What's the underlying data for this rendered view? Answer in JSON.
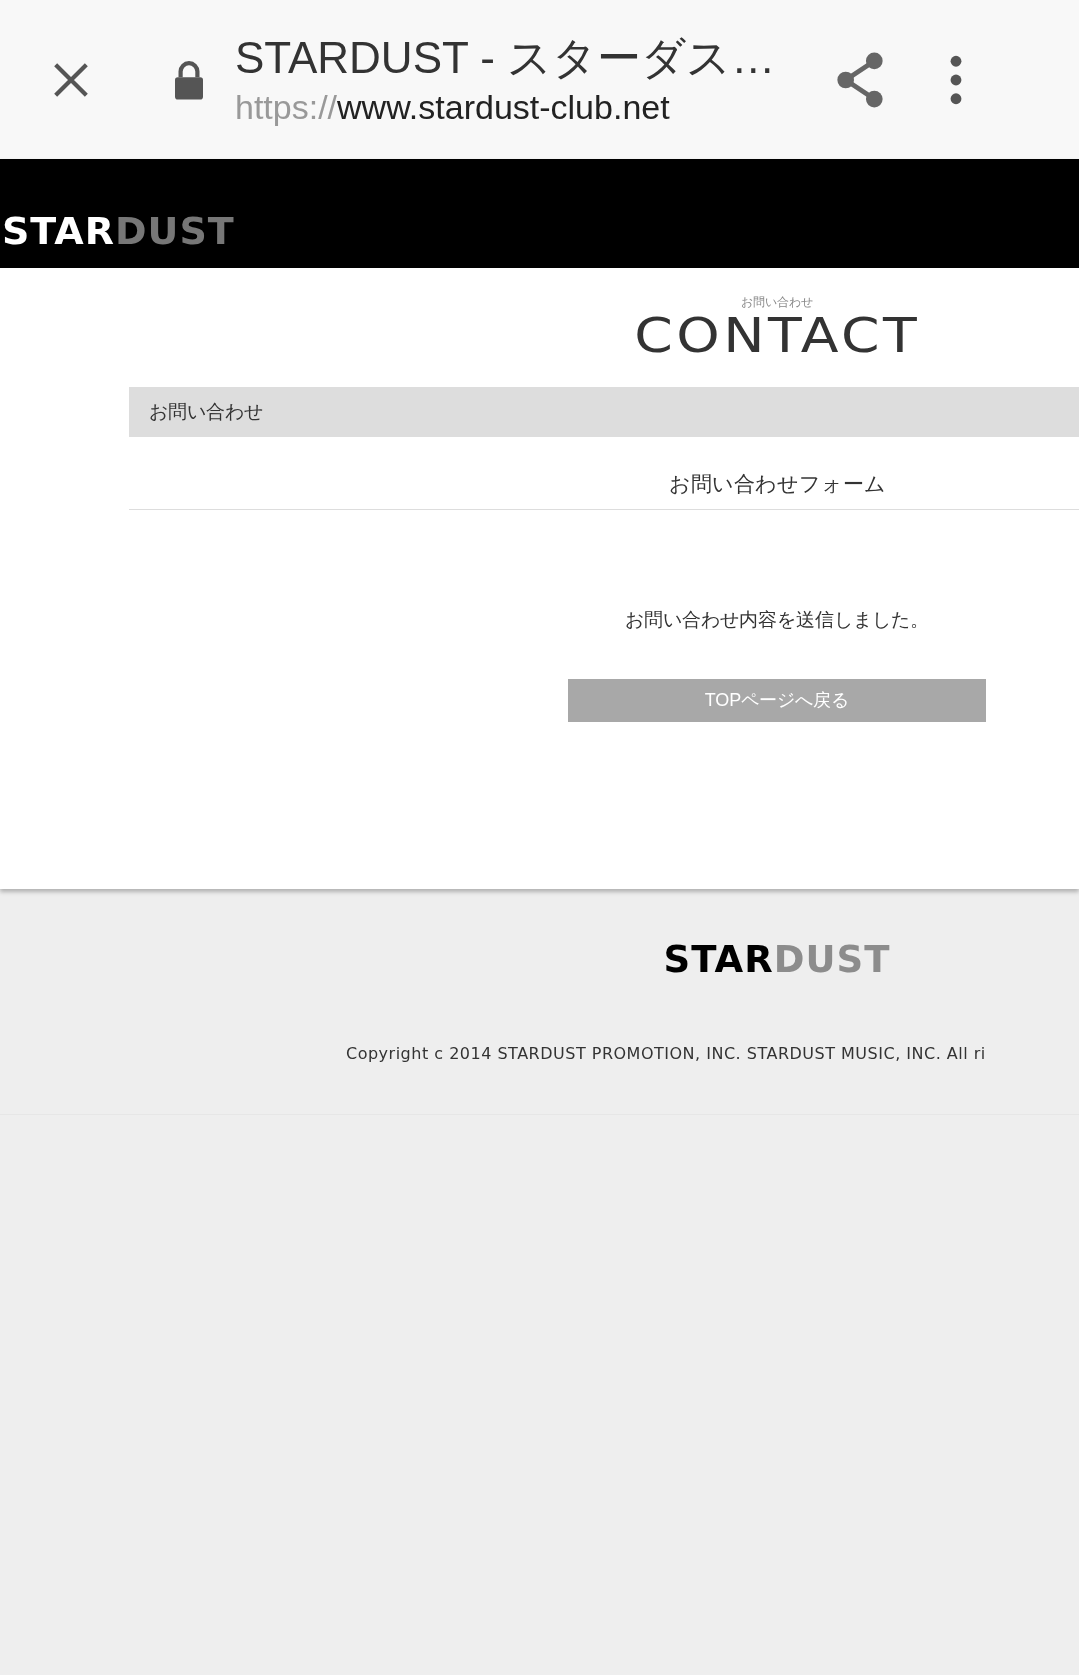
{
  "browser_bar": {
    "title": "STARDUST - スターダス…",
    "url_scheme": "https://",
    "url_host": "www.stardust-club.net"
  },
  "header": {
    "logo": {
      "part_1": "STAR",
      "part_2": "DUST"
    }
  },
  "contact": {
    "ruby": "お問い合わせ",
    "heading": "CONTACT",
    "breadcrumb": "お問い合わせ",
    "form_title": "お問い合わせフォーム",
    "message": "お問い合わせ内容を送信しました。",
    "button": "TOPページへ戻る"
  },
  "footer": {
    "logo": {
      "part_1": "STAR",
      "part_2": "DUST"
    },
    "copyright": "Copyright c 2014 STARDUST PROMOTION, INC. STARDUST MUSIC, INC. All ri"
  }
}
